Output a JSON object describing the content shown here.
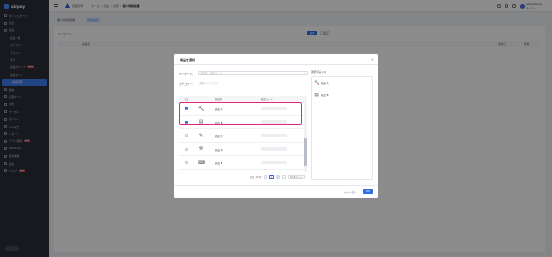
{
  "app": {
    "logo_text": "airpay"
  },
  "sidebar": {
    "items": [
      {
        "label": "ダッシュボード",
        "indent": false,
        "active": false
      },
      {
        "label": "注文",
        "indent": false,
        "active": false
      },
      {
        "label": "商品",
        "indent": false,
        "active": false
      },
      {
        "label": "商品一覧",
        "indent": true,
        "active": false
      },
      {
        "label": "カテゴリー",
        "indent": true,
        "active": false
      },
      {
        "label": "ブランド",
        "indent": true,
        "active": false
      },
      {
        "label": "タグ",
        "indent": true,
        "active": false
      },
      {
        "label": "商品グループ",
        "indent": true,
        "active": false,
        "badge": "NEW"
      },
      {
        "label": "商品セット",
        "indent": true,
        "active": false
      },
      {
        "label": "在庫管理",
        "indent": true,
        "active": true
      },
      {
        "label": "顧客",
        "indent": false,
        "active": false
      },
      {
        "label": "店舗サイト",
        "indent": false,
        "active": false
      },
      {
        "label": "決済",
        "indent": false,
        "active": false
      },
      {
        "label": "クーポン",
        "indent": false,
        "active": false
      },
      {
        "label": "ポイント",
        "indent": false,
        "active": false
      },
      {
        "label": "メルマガ",
        "indent": false,
        "active": false
      },
      {
        "label": "レポート",
        "indent": false,
        "active": false
      },
      {
        "label": "アプリ連携",
        "indent": false,
        "active": false,
        "badge": "NEW"
      },
      {
        "label": "Webhook",
        "indent": false,
        "active": false
      },
      {
        "label": "操作履歴",
        "indent": false,
        "active": false
      },
      {
        "label": "設定",
        "indent": false,
        "active": false
      },
      {
        "label": "ヘルプ",
        "indent": false,
        "active": false,
        "badge": "NEW"
      }
    ]
  },
  "header": {
    "store_name": "店舗名称",
    "breadcrumb": [
      "ホーム",
      "商品",
      "在庫",
      "個人情報保護"
    ],
    "user_name": "admin@airpay",
    "user_role": "オーナー"
  },
  "main": {
    "tabs": [
      {
        "label": "個人情報保護",
        "active": false
      },
      {
        "label": "商品設定",
        "active": true
      }
    ],
    "keyword_label": "キーワード：",
    "search_button": "検索",
    "add_button": "追加",
    "col_product": "商品名",
    "col_date": "更新日",
    "col_count": "件数"
  },
  "modal": {
    "title": "商品を選択",
    "keyword_label": "キーワード：",
    "keyword_placeholder": "商品名、商品コード",
    "category_label": "カテゴリー：",
    "category_placeholder": "選択してください",
    "col_product_name": "商品名",
    "col_product_code": "商品コード",
    "products": [
      {
        "name": "商品 A",
        "icon": "🔨",
        "checked": true
      },
      {
        "name": "商品 B",
        "icon": "▤",
        "checked": true
      },
      {
        "name": "商品 C",
        "icon": "✎",
        "checked": false
      },
      {
        "name": "商品 D",
        "icon": "⚒",
        "checked": false
      },
      {
        "name": "商品 E",
        "icon": "⌨",
        "checked": false
      }
    ],
    "code_placeholder": "",
    "pager": {
      "total": "合計 10 件",
      "prev": "‹",
      "page1": "1",
      "page2": "2",
      "next": "›",
      "size": "10 件/ページ"
    },
    "selected_label": "選択済み (2)",
    "selected": [
      {
        "name": "商品 A",
        "icon": "🔨"
      },
      {
        "name": "商品 B",
        "icon": "▤"
      }
    ],
    "cancel_button": "キャンセル",
    "ok_button": "OK"
  },
  "colors": {
    "accent": "#2f6ee5",
    "sidebar": "#2b2f3a",
    "highlight": "#e0287b"
  }
}
